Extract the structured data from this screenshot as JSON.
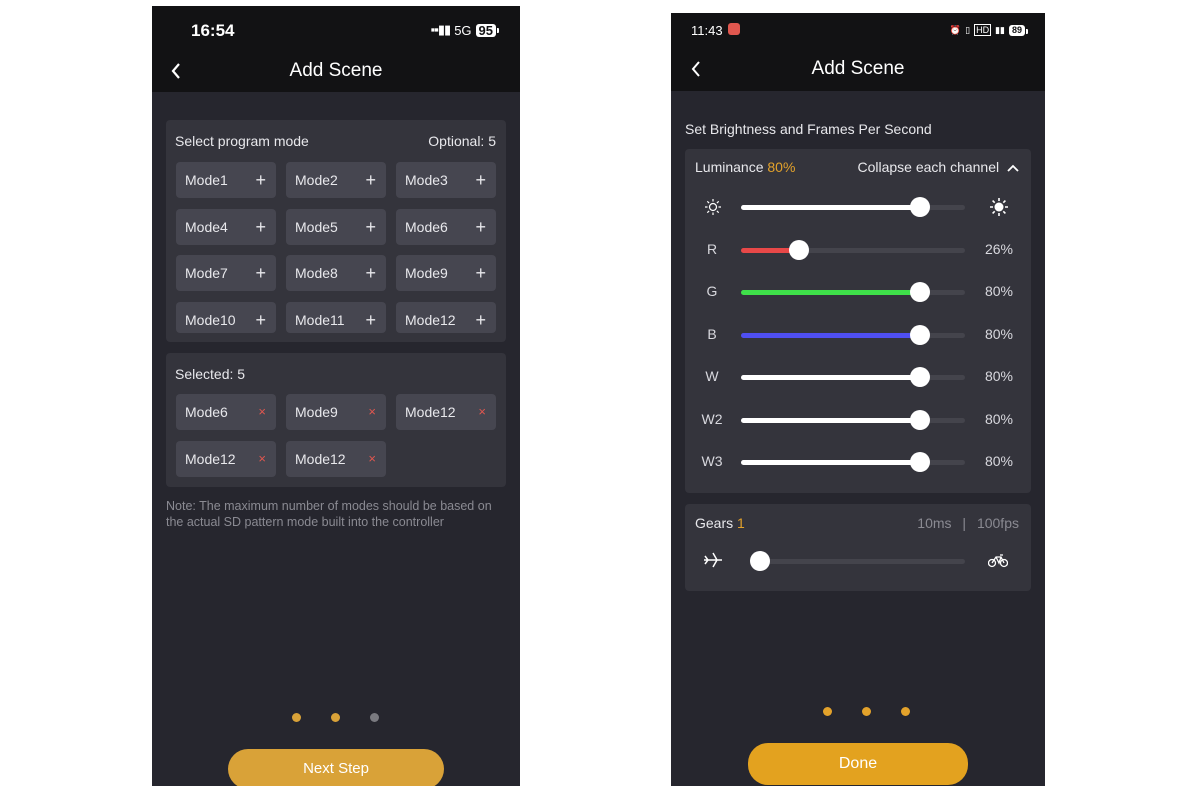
{
  "left": {
    "status": {
      "time": "16:54",
      "signal": "5G",
      "battery": "95"
    },
    "title": "Add Scene",
    "program": {
      "label": "Select program mode",
      "optional": "Optional: 5",
      "modes": [
        "Mode1",
        "Mode2",
        "Mode3",
        "Mode4",
        "Mode5",
        "Mode6",
        "Mode7",
        "Mode8",
        "Mode9",
        "Mode10",
        "Mode11",
        "Mode12"
      ],
      "add_icon": "+"
    },
    "selected": {
      "label": "Selected: 5",
      "items": [
        "Mode6",
        "Mode9",
        "Mode12",
        "Mode12",
        "Mode12"
      ],
      "remove_icon": "×"
    },
    "note": "Note: The maximum number of modes should be based on the actual SD pattern mode built into the controller",
    "pager": {
      "active": 2,
      "total": 3
    },
    "next_label": "Next Step"
  },
  "right": {
    "status": {
      "time": "11:43",
      "battery": "89"
    },
    "title": "Add Scene",
    "section_title": "Set Brightness and Frames Per Second",
    "luminance": {
      "label": "Luminance",
      "value": "80%",
      "collapse": "Collapse each channel"
    },
    "channels": [
      {
        "name": "brightness",
        "label": "",
        "value": 0.8,
        "color": "#ffffff",
        "pct": ""
      },
      {
        "name": "R",
        "label": "R",
        "value": 0.26,
        "color": "#e84848",
        "pct": "26%"
      },
      {
        "name": "G",
        "label": "G",
        "value": 0.8,
        "color": "#3fe04a",
        "pct": "80%"
      },
      {
        "name": "B",
        "label": "B",
        "value": 0.8,
        "color": "#4f4ff2",
        "pct": "80%"
      },
      {
        "name": "W",
        "label": "W",
        "value": 0.8,
        "color": "#ffffff",
        "pct": "80%"
      },
      {
        "name": "W2",
        "label": "W2",
        "value": 0.8,
        "color": "#ffffff",
        "pct": "80%"
      },
      {
        "name": "W3",
        "label": "W3",
        "value": 0.8,
        "color": "#ffffff",
        "pct": "80%"
      }
    ],
    "gears": {
      "label": "Gears",
      "value": "1",
      "ms": "10ms",
      "sep": "|",
      "fps": "100fps",
      "slider": 0.04
    },
    "pager": {
      "active": 3,
      "total": 3
    },
    "done_label": "Done"
  },
  "colors": {
    "accent": "#e3a22b",
    "button": "#d9a238",
    "panel": "#34343c",
    "background": "#26262e",
    "topbar": "#121214"
  }
}
